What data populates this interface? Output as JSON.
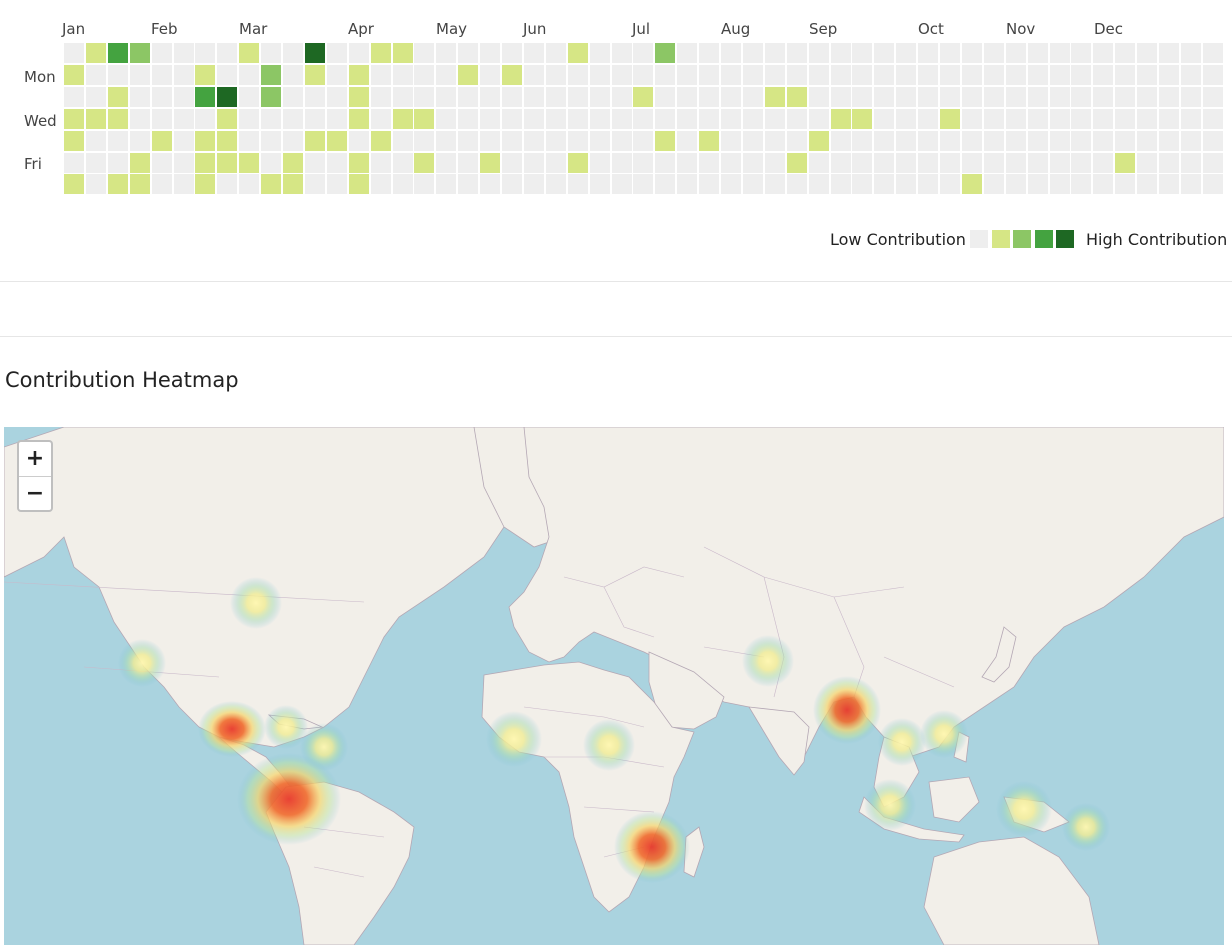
{
  "calendar": {
    "months": [
      "Jan",
      "Feb",
      "Mar",
      "Apr",
      "May",
      "Jun",
      "Jul",
      "Aug",
      "Sep",
      "Oct",
      "Nov",
      "Dec"
    ],
    "day_labels": [
      "Mon",
      "Wed",
      "Fri"
    ],
    "weeks": 53,
    "days_per_week": 7,
    "contributions": [
      {
        "week": 0,
        "day": 1,
        "level": 1
      },
      {
        "week": 0,
        "day": 3,
        "level": 1
      },
      {
        "week": 0,
        "day": 4,
        "level": 1
      },
      {
        "week": 0,
        "day": 6,
        "level": 1
      },
      {
        "week": 1,
        "day": 0,
        "level": 1
      },
      {
        "week": 1,
        "day": 3,
        "level": 1
      },
      {
        "week": 2,
        "day": 0,
        "level": 3
      },
      {
        "week": 2,
        "day": 2,
        "level": 1
      },
      {
        "week": 2,
        "day": 3,
        "level": 1
      },
      {
        "week": 2,
        "day": 6,
        "level": 1
      },
      {
        "week": 3,
        "day": 0,
        "level": 2
      },
      {
        "week": 3,
        "day": 5,
        "level": 1
      },
      {
        "week": 3,
        "day": 6,
        "level": 1
      },
      {
        "week": 4,
        "day": 4,
        "level": 1
      },
      {
        "week": 6,
        "day": 1,
        "level": 1
      },
      {
        "week": 6,
        "day": 2,
        "level": 3
      },
      {
        "week": 6,
        "day": 4,
        "level": 1
      },
      {
        "week": 6,
        "day": 5,
        "level": 1
      },
      {
        "week": 6,
        "day": 6,
        "level": 1
      },
      {
        "week": 7,
        "day": 2,
        "level": 4
      },
      {
        "week": 7,
        "day": 3,
        "level": 1
      },
      {
        "week": 7,
        "day": 4,
        "level": 1
      },
      {
        "week": 7,
        "day": 5,
        "level": 1
      },
      {
        "week": 8,
        "day": 0,
        "level": 1
      },
      {
        "week": 8,
        "day": 5,
        "level": 1
      },
      {
        "week": 9,
        "day": 1,
        "level": 2
      },
      {
        "week": 9,
        "day": 2,
        "level": 2
      },
      {
        "week": 9,
        "day": 6,
        "level": 1
      },
      {
        "week": 10,
        "day": 5,
        "level": 1
      },
      {
        "week": 10,
        "day": 6,
        "level": 1
      },
      {
        "week": 11,
        "day": 0,
        "level": 4
      },
      {
        "week": 11,
        "day": 1,
        "level": 1
      },
      {
        "week": 11,
        "day": 4,
        "level": 1
      },
      {
        "week": 12,
        "day": 4,
        "level": 1
      },
      {
        "week": 13,
        "day": 1,
        "level": 1
      },
      {
        "week": 13,
        "day": 2,
        "level": 1
      },
      {
        "week": 13,
        "day": 3,
        "level": 1
      },
      {
        "week": 13,
        "day": 5,
        "level": 1
      },
      {
        "week": 13,
        "day": 6,
        "level": 1
      },
      {
        "week": 14,
        "day": 0,
        "level": 1
      },
      {
        "week": 14,
        "day": 4,
        "level": 1
      },
      {
        "week": 15,
        "day": 0,
        "level": 1
      },
      {
        "week": 15,
        "day": 3,
        "level": 1
      },
      {
        "week": 16,
        "day": 3,
        "level": 1
      },
      {
        "week": 16,
        "day": 5,
        "level": 1
      },
      {
        "week": 18,
        "day": 1,
        "level": 1
      },
      {
        "week": 19,
        "day": 5,
        "level": 1
      },
      {
        "week": 20,
        "day": 1,
        "level": 1
      },
      {
        "week": 23,
        "day": 0,
        "level": 1
      },
      {
        "week": 23,
        "day": 5,
        "level": 1
      },
      {
        "week": 26,
        "day": 2,
        "level": 1
      },
      {
        "week": 27,
        "day": 0,
        "level": 2
      },
      {
        "week": 27,
        "day": 4,
        "level": 1
      },
      {
        "week": 29,
        "day": 4,
        "level": 1
      },
      {
        "week": 32,
        "day": 2,
        "level": 1
      },
      {
        "week": 33,
        "day": 2,
        "level": 1
      },
      {
        "week": 33,
        "day": 5,
        "level": 1
      },
      {
        "week": 34,
        "day": 4,
        "level": 1
      },
      {
        "week": 35,
        "day": 3,
        "level": 1
      },
      {
        "week": 36,
        "day": 3,
        "level": 1
      },
      {
        "week": 40,
        "day": 3,
        "level": 1
      },
      {
        "week": 41,
        "day": 6,
        "level": 1
      },
      {
        "week": 48,
        "day": 5,
        "level": 1
      }
    ],
    "level_colors": [
      "#eeeeee",
      "#d6e685",
      "#8cc665",
      "#44a340",
      "#1e6823"
    ]
  },
  "legend": {
    "low_label": "Low Contribution",
    "high_label": "High Contribution"
  },
  "heatmap": {
    "title": "Contribution Heatmap",
    "zoom_in": "+",
    "zoom_out": "−",
    "colors": {
      "ocean": "#aad3df",
      "land": "#f2efe9",
      "border": "#b4a7b4"
    },
    "hotspots": [
      {
        "place": "Great Lakes",
        "intensity": 0.3
      },
      {
        "place": "Southern California",
        "intensity": 0.3
      },
      {
        "place": "Mexico",
        "intensity": 0.8
      },
      {
        "place": "Caribbean",
        "intensity": 0.3
      },
      {
        "place": "Venezuela",
        "intensity": 0.35
      },
      {
        "place": "Colombia / Ecuador",
        "intensity": 1.0
      },
      {
        "place": "West Africa",
        "intensity": 0.3
      },
      {
        "place": "Chad / Sudan",
        "intensity": 0.3
      },
      {
        "place": "Mozambique",
        "intensity": 0.85
      },
      {
        "place": "Afghanistan / Pakistan",
        "intensity": 0.35
      },
      {
        "place": "Bangladesh / Myanmar",
        "intensity": 0.95
      },
      {
        "place": "Vietnam",
        "intensity": 0.35
      },
      {
        "place": "Philippines",
        "intensity": 0.3
      },
      {
        "place": "Java",
        "intensity": 0.35
      },
      {
        "place": "Papua New Guinea",
        "intensity": 0.35
      },
      {
        "place": "Solomon Islands",
        "intensity": 0.3
      }
    ]
  }
}
